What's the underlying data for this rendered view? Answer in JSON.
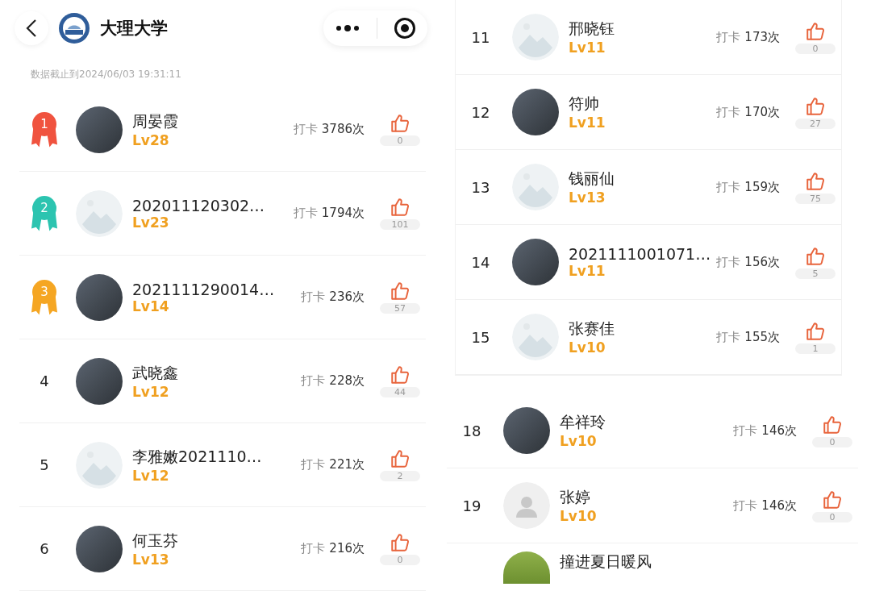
{
  "header": {
    "title": "大理大学"
  },
  "left": {
    "timestamp": "数据截止到2024/06/03 19:31:11",
    "rows": [
      {
        "rank": "1",
        "kind": "medal",
        "color": "#f0533f",
        "avatar": {
          "kind": "photo"
        },
        "name": "周晏霞",
        "level": "Lv28",
        "label": "打卡",
        "count": "3786次",
        "likes": "0"
      },
      {
        "rank": "2",
        "kind": "medal",
        "color": "#2cc4b0",
        "avatar": {
          "kind": "placeholder"
        },
        "name": "202011120302…",
        "level": "Lv23",
        "label": "打卡",
        "count": "1794次",
        "likes": "101"
      },
      {
        "rank": "3",
        "kind": "medal",
        "color": "#f5a623",
        "avatar": {
          "kind": "photo"
        },
        "name": "2021111290014…",
        "level": "Lv14",
        "label": "打卡",
        "count": "236次",
        "likes": "57"
      },
      {
        "rank": "4",
        "kind": "plain",
        "avatar": {
          "kind": "photo"
        },
        "name": "武晓鑫",
        "level": "Lv12",
        "label": "打卡",
        "count": "228次",
        "likes": "44"
      },
      {
        "rank": "5",
        "kind": "plain",
        "avatar": {
          "kind": "placeholder"
        },
        "name": "李雅嫩2021110…",
        "level": "Lv12",
        "label": "打卡",
        "count": "221次",
        "likes": "2"
      },
      {
        "rank": "6",
        "kind": "plain",
        "avatar": {
          "kind": "photo"
        },
        "name": "何玉芬",
        "level": "Lv13",
        "label": "打卡",
        "count": "216次",
        "likes": "0"
      }
    ]
  },
  "right_top": {
    "rows": [
      {
        "rank": "11",
        "kind": "plain",
        "avatar": {
          "kind": "placeholder"
        },
        "name": "邢晓钰",
        "level": "Lv11",
        "label": "打卡",
        "count": "173次",
        "likes": "0"
      },
      {
        "rank": "12",
        "kind": "plain",
        "avatar": {
          "kind": "photo"
        },
        "name": "符帅",
        "level": "Lv11",
        "label": "打卡",
        "count": "170次",
        "likes": "27"
      },
      {
        "rank": "13",
        "kind": "plain",
        "avatar": {
          "kind": "placeholder"
        },
        "name": "钱丽仙",
        "level": "Lv13",
        "label": "打卡",
        "count": "159次",
        "likes": "75"
      },
      {
        "rank": "14",
        "kind": "plain",
        "avatar": {
          "kind": "photo"
        },
        "name": "2021111001071…",
        "level": "Lv11",
        "label": "打卡",
        "count": "156次",
        "likes": "5"
      },
      {
        "rank": "15",
        "kind": "plain",
        "avatar": {
          "kind": "placeholder"
        },
        "name": "张赛佳",
        "level": "Lv10",
        "label": "打卡",
        "count": "155次",
        "likes": "1"
      }
    ]
  },
  "right_bottom": {
    "rows": [
      {
        "rank": "18",
        "kind": "plain",
        "avatar": {
          "kind": "photo"
        },
        "name": "牟祥玲",
        "level": "Lv10",
        "label": "打卡",
        "count": "146次",
        "likes": "0"
      },
      {
        "rank": "19",
        "kind": "plain",
        "avatar": {
          "kind": "silhouette"
        },
        "name": "张婷",
        "level": "Lv10",
        "label": "打卡",
        "count": "146次",
        "likes": "0"
      }
    ],
    "partial_row": {
      "avatar": {
        "kind": "photo"
      },
      "name": "撞进夏日暖风"
    }
  }
}
